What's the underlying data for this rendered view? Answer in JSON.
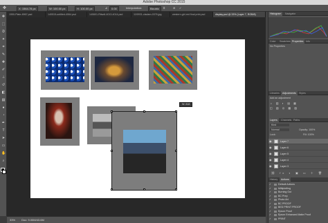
{
  "app": {
    "title": "Adobe Photoshop CC 2015"
  },
  "options": {
    "x": "X: 1564.78 px",
    "w": "W: 100.00 px",
    "h": "H: 100.00 px",
    "angle": "0.00",
    "interpolation": "Interpolation:",
    "interp_value": "Bicubic"
  },
  "tabs": [
    "1550-Plate-8967.psd",
    "140515-untitled-4064.psd",
    "140601-Rttwdl-4013-4014.psd",
    "11f0931-vladam-0376.jpg",
    "western-girl-red final print.psd",
    "display.psd @ 33% (Layer 7, RGB/8)"
  ],
  "status": {
    "zoom": "33%",
    "doc": "Doc: 9.00M/43.6M"
  },
  "tooltip": "W: 818",
  "tools": [
    "move-icon",
    "marquee-icon",
    "lasso-icon",
    "wand-icon",
    "crop-icon",
    "eyedropper-icon",
    "healing-icon",
    "brush-icon",
    "stamp-icon",
    "history-brush-icon",
    "eraser-icon",
    "gradient-icon",
    "blur-icon",
    "dodge-icon",
    "pen-icon",
    "type-icon",
    "path-select-icon",
    "shape-icon",
    "hand-icon",
    "zoom-icon"
  ],
  "panels": {
    "histogram_tabs": [
      "Histogram",
      "Navigator"
    ],
    "props_tabs": [
      "Color",
      "Swatches",
      "Properties",
      "Info"
    ],
    "props_text": "No Properties",
    "lib_tabs": [
      "Libraries",
      "Adjustments",
      "Styles"
    ],
    "adjust_text": "Add an adjustment",
    "layer_tabs": [
      "Layers",
      "Channels",
      "Paths"
    ],
    "kind": "Kind",
    "blend": "Normal",
    "opacity": "Opacity: 100%",
    "lock": "Lock:",
    "fill": "Fill: 100%",
    "layers": [
      "Layer 7",
      "Layer 6",
      "Layer 5",
      "Layer 4",
      "Layer 3"
    ],
    "history_tabs": [
      "History",
      "Actions"
    ],
    "actions": [
      "Default Actions",
      "Miltiplotting",
      "Burning Out",
      "BC Prep",
      "Photo Art",
      "BC PROOF",
      "BED PRINT PROOF",
      "Epson Proof",
      "Epson Enhanced Matte Proof",
      "PRINT"
    ]
  }
}
